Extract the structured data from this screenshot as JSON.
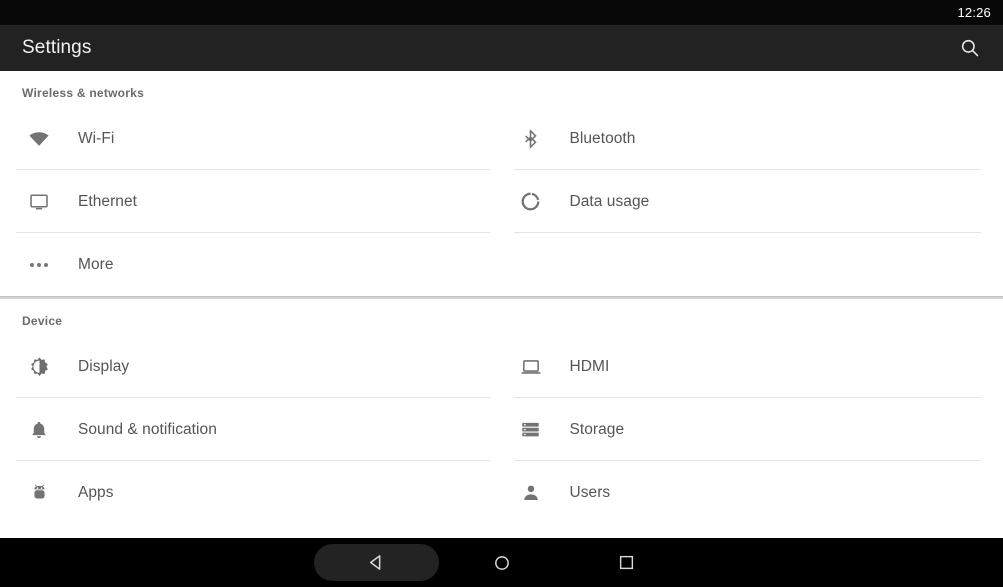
{
  "status_bar": {
    "time": "12:26"
  },
  "app_bar": {
    "title": "Settings",
    "search_icon": "search-icon"
  },
  "colors": {
    "status_bar_bg": "#080808",
    "app_bar_bg": "#222222",
    "page_bg": "#ffffff",
    "nav_bar_bg": "#000000",
    "label_text": "#555555",
    "header_text": "#6b6b6b",
    "icon_gray": "#737373",
    "divider": "#e4e4e4",
    "section_divider": "#d2d2d2"
  },
  "sections": [
    {
      "header": "Wireless & networks",
      "items": [
        {
          "label": "Wi-Fi",
          "icon": "wifi-icon"
        },
        {
          "label": "Bluetooth",
          "icon": "bluetooth-icon"
        },
        {
          "label": "Ethernet",
          "icon": "monitor-icon"
        },
        {
          "label": "Data usage",
          "icon": "data-usage-donut-icon"
        },
        {
          "label": "More",
          "icon": "ellipsis-icon"
        }
      ]
    },
    {
      "header": "Device",
      "items": [
        {
          "label": "Display",
          "icon": "brightness-icon"
        },
        {
          "label": "HDMI",
          "icon": "laptop-screen-icon"
        },
        {
          "label": "Sound & notification",
          "icon": "bell-icon"
        },
        {
          "label": "Storage",
          "icon": "storage-stack-icon"
        },
        {
          "label": "Apps",
          "icon": "android-robot-icon"
        },
        {
          "label": "Users",
          "icon": "person-icon"
        }
      ]
    }
  ],
  "nav_bar": {
    "back_label": "Back",
    "home_label": "Home",
    "recents_label": "Recent apps",
    "back_icon": "back-triangle-icon",
    "home_icon": "home-circle-icon",
    "recents_icon": "recents-square-icon"
  }
}
